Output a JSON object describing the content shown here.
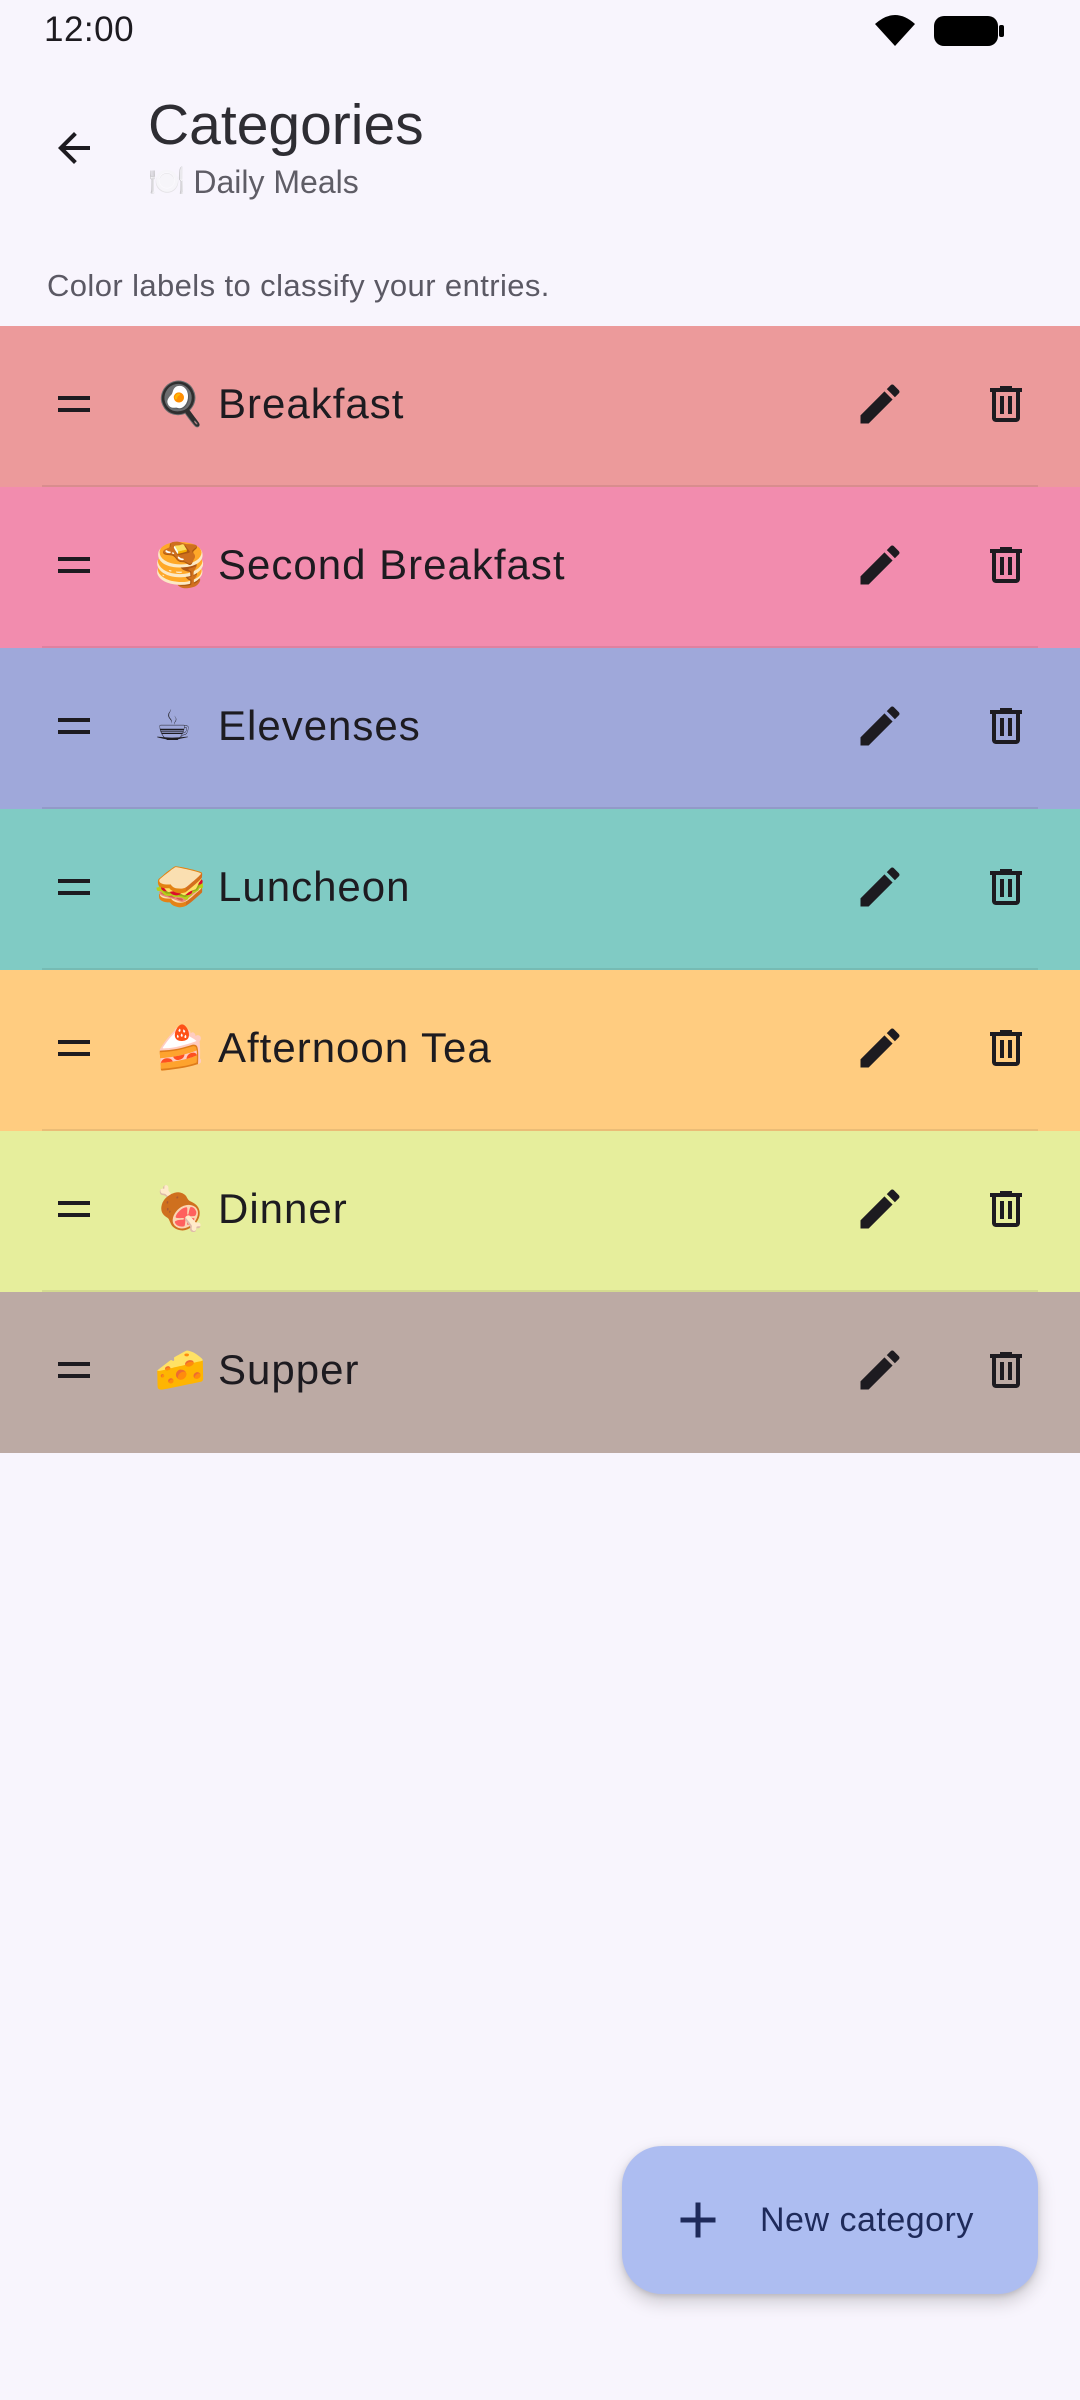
{
  "status_bar": {
    "time": "12:00",
    "icons": [
      "wifi-icon",
      "battery-icon"
    ]
  },
  "header": {
    "back_icon": "arrow-back-icon",
    "title": "Categories",
    "subtitle_icon": "🍽️",
    "subtitle": "Daily Meals"
  },
  "description": "Color labels to classify your entries.",
  "categories": [
    {
      "emoji": "🍳",
      "label": "Breakfast",
      "color": "#ec9a9b"
    },
    {
      "emoji": "🥞",
      "label": "Second Breakfast",
      "color": "#f28cae"
    },
    {
      "emoji": "☕",
      "label": "Elevenses",
      "color": "#9fa8da"
    },
    {
      "emoji": "🥪",
      "label": "Luncheon",
      "color": "#80cbc4"
    },
    {
      "emoji": "🍰",
      "label": "Afternoon Tea",
      "color": "#ffcc80"
    },
    {
      "emoji": "🍖",
      "label": "Dinner",
      "color": "#e6ee9c"
    },
    {
      "emoji": "🧀",
      "label": "Supper",
      "color": "#bcaaa4"
    }
  ],
  "row_icons": {
    "drag": "drag-handle-icon",
    "edit": "pencil-icon",
    "delete": "trash-icon"
  },
  "fab": {
    "icon": "plus-icon",
    "label": "New category",
    "color": "#adbdf1"
  }
}
